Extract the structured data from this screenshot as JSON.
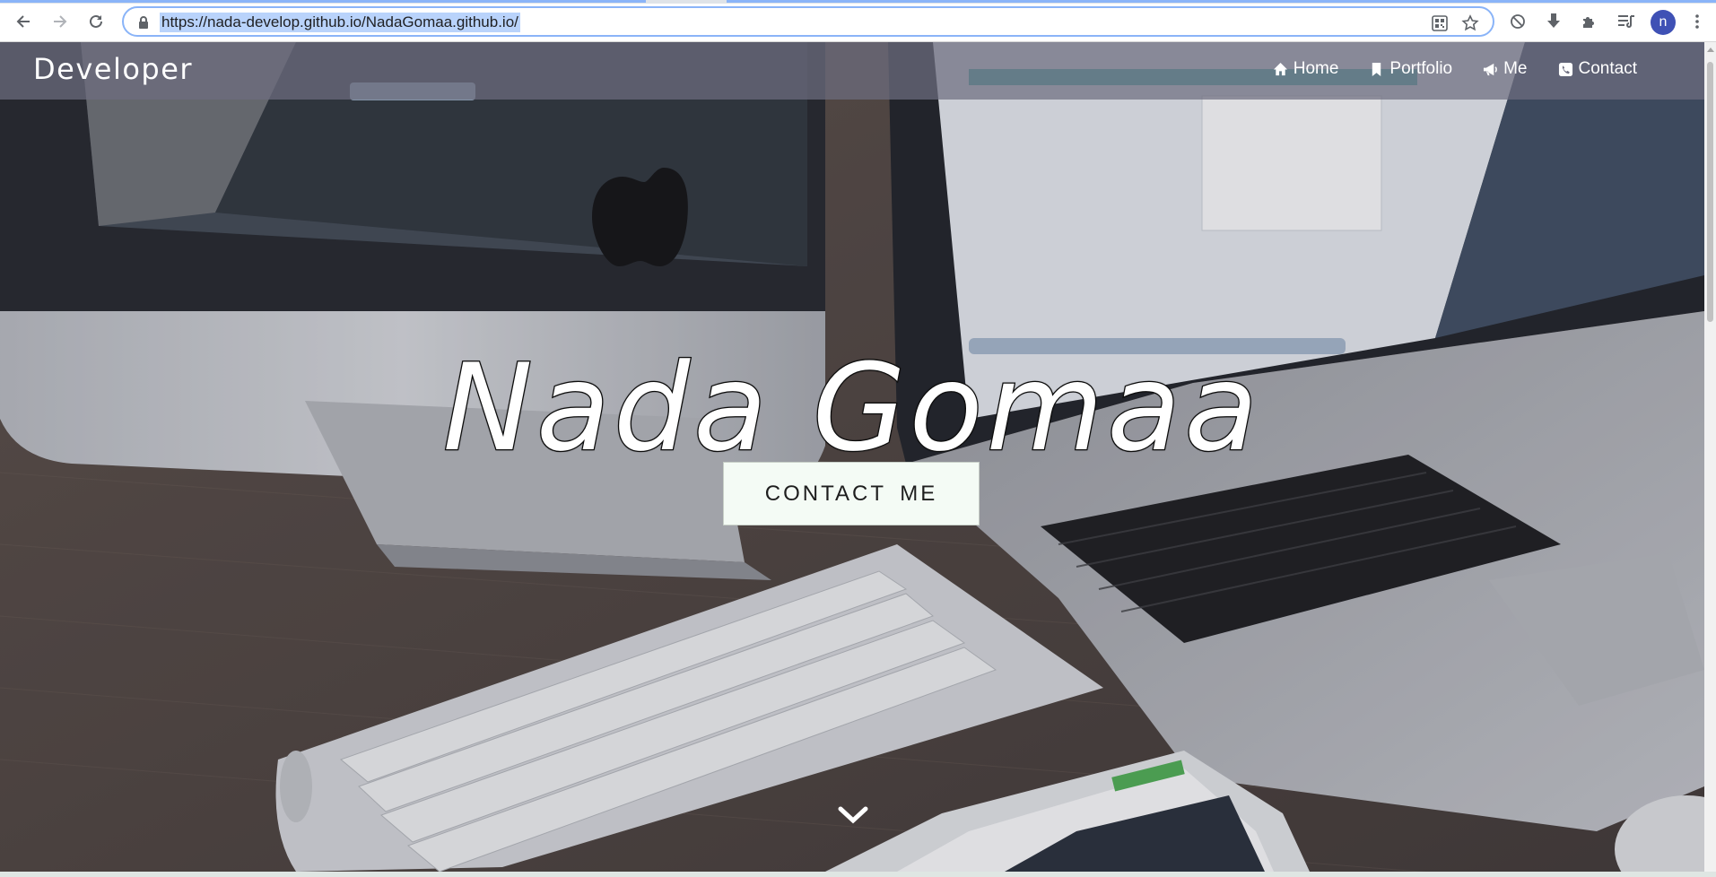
{
  "browser": {
    "url": "https://nada-develop.github.io/NadaGomaa.github.io/",
    "profile_initial": "n",
    "icons": [
      "back-arrow-icon",
      "forward-arrow-icon",
      "reload-icon",
      "lock-icon",
      "qr-code-icon",
      "bookmark-star-icon",
      "blocked-icon",
      "download-icon",
      "extensions-puzzle-icon",
      "reading-list-icon",
      "menu-dots-icon"
    ]
  },
  "navbar": {
    "brand": "Developer",
    "links": [
      {
        "label": "Home",
        "icon": "home-icon"
      },
      {
        "label": "Portfolio",
        "icon": "bookmark-icon"
      },
      {
        "label": "Me",
        "icon": "bullhorn-icon"
      },
      {
        "label": "Contact",
        "icon": "phone-icon"
      }
    ]
  },
  "hero": {
    "title": "Nada Gomaa",
    "cta_label": "CONTACT ME",
    "scroll_icon": "chevron-down-icon"
  },
  "colors": {
    "navbar_bg": "#6e6e80",
    "cta_bg": "#f4fbf5",
    "omnibox_focus": "#8ab4f8",
    "profile_bg": "#3f51b5"
  }
}
